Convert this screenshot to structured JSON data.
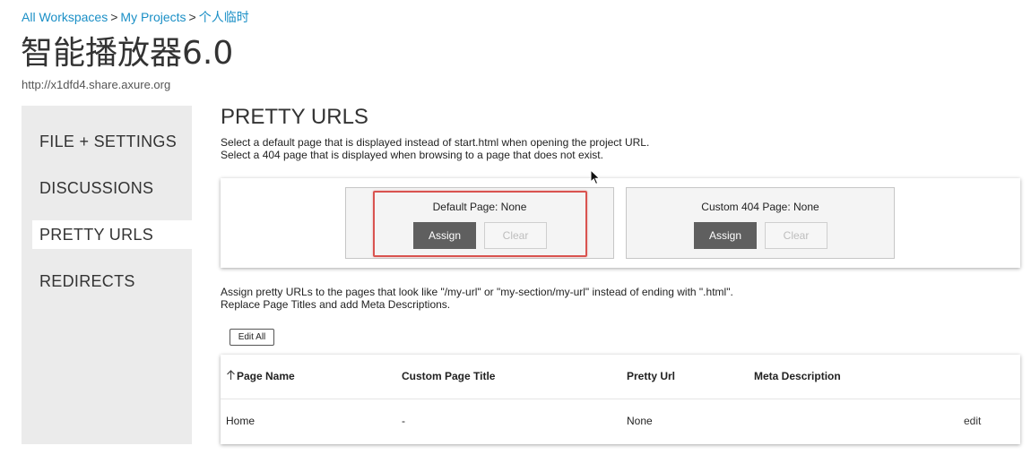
{
  "breadcrumb": {
    "items": [
      "All Workspaces",
      "My Projects",
      "个人临时"
    ],
    "separator": ">"
  },
  "project": {
    "title": "智能播放器6.0",
    "url": "http://x1dfd4.share.axure.org"
  },
  "sidebar": {
    "items": [
      {
        "label": "FILE + SETTINGS"
      },
      {
        "label": "DISCUSSIONS"
      },
      {
        "label": "PRETTY URLS"
      },
      {
        "label": "REDIRECTS"
      }
    ],
    "active": "PRETTY URLS"
  },
  "main": {
    "title": "PRETTY URLS",
    "description": [
      "Select a default page that is displayed instead of start.html when opening the project URL.",
      "Select a 404 page that is displayed when browsing to a page that does not exist."
    ],
    "default_page": {
      "label": "Default Page: None",
      "assign": "Assign",
      "clear": "Clear"
    },
    "custom_404": {
      "label": "Custom 404 Page: None",
      "assign": "Assign",
      "clear": "Clear"
    },
    "pretty_desc": [
      "Assign pretty URLs to the pages that look like \"/my-url\" or \"my-section/my-url\" instead of ending with \".html\".",
      "Replace Page Titles and add Meta Descriptions."
    ],
    "edit_all": "Edit All"
  },
  "table": {
    "headers": [
      "Page Name",
      "Custom Page Title",
      "Pretty Url",
      "Meta Description"
    ],
    "rows": [
      {
        "page_name": "Home",
        "custom_title": "-",
        "pretty_url": "None",
        "meta": "",
        "action": "edit"
      }
    ]
  },
  "colors": {
    "link": "#1a8fc6",
    "assign_button": "#5f5f5f",
    "highlight": "#d9534f",
    "sidebar_bg": "#ebebeb"
  },
  "icons": {
    "sort": "arrow-up-icon",
    "cursor": "mouse-pointer-icon"
  }
}
